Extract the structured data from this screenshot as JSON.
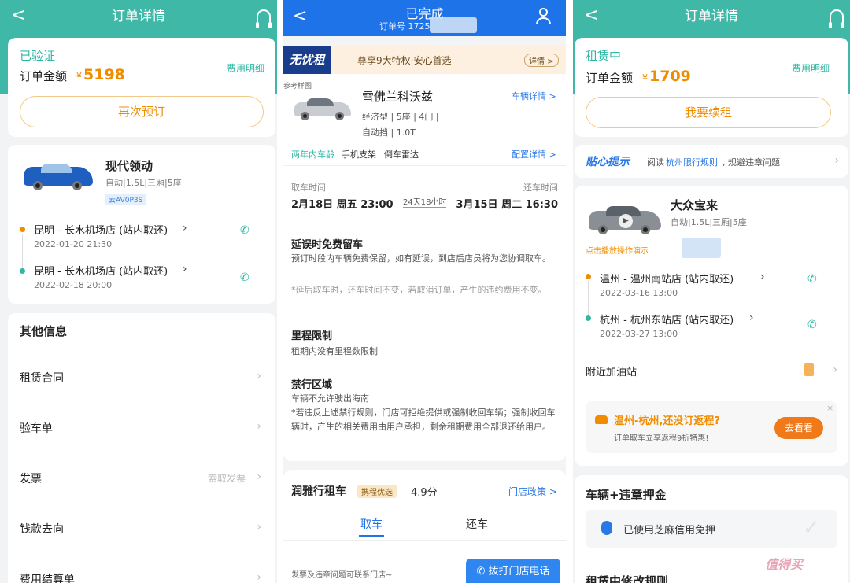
{
  "colors": {
    "teal": "#2fb7a4",
    "blue": "#1e73e8",
    "orange": "#f08c00"
  },
  "p1": {
    "header": {
      "back": "<",
      "title": "订单详情",
      "icon": "headset-icon"
    },
    "status": "已验证",
    "fee_link": "费用明细",
    "amount_label": "订单金额",
    "currency": "¥",
    "amount": "5198",
    "rebook": "再次预订",
    "car": {
      "name": "现代领动",
      "specs": "自动|1.5L|三厢|5座",
      "plate": "云AV0P3S"
    },
    "pickup": {
      "place": "昆明 - 长水机场店 (站内取还)",
      "time": "2022-01-20 21:30"
    },
    "dropoff": {
      "place": "昆明 - 长水机场店 (站内取还)",
      "time": "2022-02-18 20:00"
    },
    "other_title": "其他信息",
    "rows": [
      {
        "label": "租赁合同",
        "hint": ""
      },
      {
        "label": "验车单",
        "hint": ""
      },
      {
        "label": "发票",
        "hint": "索取发票"
      },
      {
        "label": "钱款去向",
        "hint": ""
      },
      {
        "label": "费用结算单",
        "hint": ""
      }
    ]
  },
  "p2": {
    "header": {
      "back": "<",
      "title": "已完成",
      "order_no": "订单号 1725",
      "icon": "customer-service-icon"
    },
    "banner": {
      "badge": "无忧租",
      "text": "尊享9大特权·安心首选",
      "detail": "详情 >"
    },
    "ref_img": "参考样图",
    "car": {
      "name": "雪佛兰科沃兹",
      "tags": "经济型 | 5座 | 4门 |",
      "tags2": "自动挡 | 1.0T",
      "detail_link": "车辆详情 >",
      "features": "两年内车龄",
      "feature2": "手机支架",
      "feature3": "倒车雷达",
      "config_link": "配置详情 >"
    },
    "time": {
      "pick_label": "取车时间",
      "return_label": "还车时间",
      "pick": "2月18日 周五 23:00",
      "duration": "24天18小时",
      "ret": "3月15日 周二 16:30"
    },
    "rules": [
      {
        "title": "延误时免费留车",
        "body": "预订时段内车辆免费保留，如有延误，到店后店员将为您协调取车。",
        "note": "*延后取车时，还车时间不变，若取消订单，产生的违约费用不变。"
      },
      {
        "title": "里程限制",
        "body": "租期内没有里程数限制",
        "note": ""
      },
      {
        "title": "禁行区域",
        "body": "车辆不允许驶出海南",
        "note": "*若违反上述禁行规则，门店可拒绝提供或强制收回车辆；强制收回车辆时，产生的相关费用由用户承担，剩余租期费用全部退还给用户。"
      }
    ],
    "store": {
      "name": "润雅行租车",
      "badge": "携程优选",
      "score": "4.9分",
      "policy": "门店政策 >"
    },
    "tabs": [
      "取车",
      "还车"
    ],
    "footer": {
      "text": "发票及违章问题可联系门店~",
      "call": "拨打门店电话"
    }
  },
  "p3": {
    "header": {
      "back": "<",
      "title": "订单详情",
      "icon": "headset-icon"
    },
    "status": "租赁中",
    "fee_link": "费用明细",
    "amount_label": "订单金额",
    "currency": "¥",
    "amount": "1709",
    "renew": "我要续租",
    "tip": {
      "badge": "贴心提示",
      "prefix": "阅读",
      "link": "杭州限行规则",
      "suffix": ", 规避违章问题"
    },
    "car": {
      "name": "大众宝来",
      "specs": "自动|1.5L|三厢|5座",
      "video": "点击播放操作演示"
    },
    "pickup": {
      "place": "温州 - 温州南站店 (站内取还)",
      "time": "2022-03-16 13:00"
    },
    "dropoff": {
      "place": "杭州 - 杭州东站店 (站内取还)",
      "time": "2022-03-27 13:00"
    },
    "gas": "附近加油站",
    "promo": {
      "title": "温州-杭州,还没订返程?",
      "sub": "订单取车立享返程9折特惠!",
      "btn": "去看看"
    },
    "deposit_title": "车辆+违章押金",
    "deposit_text": "已使用芝麻信用免押",
    "rules_title": "租赁中修改规则",
    "watermark": "值得买"
  }
}
